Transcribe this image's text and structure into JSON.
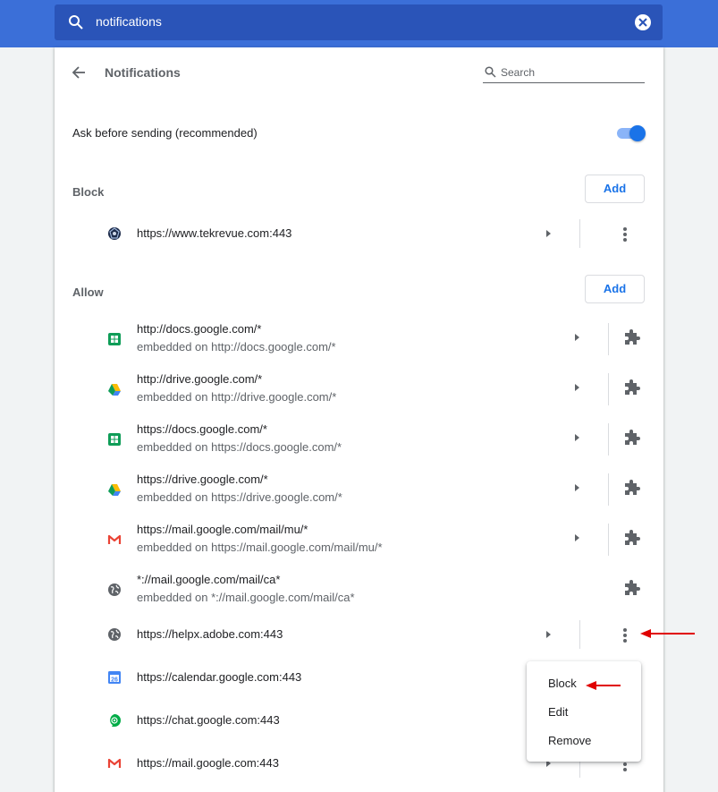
{
  "search": {
    "value": "notifications"
  },
  "header": {
    "title": "Notifications",
    "search_placeholder": "Search"
  },
  "ask": {
    "label": "Ask before sending (recommended)",
    "enabled": true
  },
  "block": {
    "label": "Block",
    "add_label": "Add",
    "sites": [
      {
        "site": "https://www.tekrevue.com:443",
        "icon": "tekrevue-favicon-icon"
      }
    ]
  },
  "allow": {
    "label": "Allow",
    "add_label": "Add",
    "sites": [
      {
        "site": "http://docs.google.com/*",
        "sub": "embedded on http://docs.google.com/*",
        "icon": "google-sheets-icon"
      },
      {
        "site": "http://drive.google.com/*",
        "sub": "embedded on http://drive.google.com/*",
        "icon": "google-drive-icon"
      },
      {
        "site": "https://docs.google.com/*",
        "sub": "embedded on https://docs.google.com/*",
        "icon": "google-sheets-icon"
      },
      {
        "site": "https://drive.google.com/*",
        "sub": "embedded on https://drive.google.com/*",
        "icon": "google-drive-icon"
      },
      {
        "site": "https://mail.google.com/mail/mu/*",
        "sub": "embedded on https://mail.google.com/mail/mu/*",
        "icon": "gmail-icon"
      },
      {
        "site": "*://mail.google.com/mail/ca*",
        "sub": "embedded on *://mail.google.com/mail/ca*",
        "icon": "globe-icon"
      },
      {
        "site": "https://helpx.adobe.com:443",
        "icon": "globe-icon"
      },
      {
        "site": "https://calendar.google.com:443",
        "icon": "google-calendar-icon",
        "calendar_day": "26"
      },
      {
        "site": "https://chat.google.com:443",
        "icon": "google-chat-icon"
      },
      {
        "site": "https://mail.google.com:443",
        "icon": "gmail-icon"
      }
    ]
  },
  "menu": {
    "items": [
      "Block",
      "Edit",
      "Remove"
    ]
  },
  "colors": {
    "accent": "#1a73e8",
    "topbar": "#3b6fd8",
    "annotation": "#e00000"
  }
}
